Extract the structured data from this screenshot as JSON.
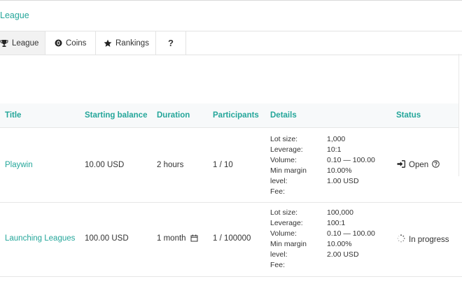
{
  "page": {
    "title": "League"
  },
  "tabs": [
    {
      "label": "League",
      "icon": "trophy-icon",
      "active": true
    },
    {
      "label": "Coins",
      "icon": "coin-icon",
      "active": false
    },
    {
      "label": "Rankings",
      "icon": "star-icon",
      "active": false
    },
    {
      "label": "?",
      "icon": "question-mark",
      "active": false
    }
  ],
  "table": {
    "headers": {
      "title": "Title",
      "starting_balance": "Starting balance",
      "duration": "Duration",
      "participants": "Participants",
      "details": "Details",
      "status": "Status"
    },
    "detail_labels": [
      "Lot size:",
      "Leverage:",
      "Volume:",
      "Min margin",
      "level:",
      "Fee:"
    ],
    "rows": [
      {
        "title": "Playwin",
        "starting_balance": "10.00 USD",
        "duration": "2 hours",
        "participants": "1 / 10",
        "details": {
          "lot_size": "1,000",
          "leverage": "10:1",
          "volume": "0.10 — 100.00",
          "min_margin_level": "10.00%",
          "fee": "1.00 USD"
        },
        "status": "Open",
        "status_icon": "sign-in-icon"
      },
      {
        "title": "Launching Leagues",
        "starting_balance": "100.00 USD",
        "duration": "1 month",
        "participants": "1 / 100000",
        "details": {
          "lot_size": "100,000",
          "leverage": "100:1",
          "volume": "0.10 — 100.00",
          "min_margin_level": "10.00%",
          "fee": "2.00 USD"
        },
        "status": "In progress",
        "status_icon": "spinner-icon"
      }
    ]
  },
  "colors": {
    "accent": "#24a69a",
    "header_bg": "#f7f9fa",
    "active_tab_bg": "#f2f2f2"
  }
}
